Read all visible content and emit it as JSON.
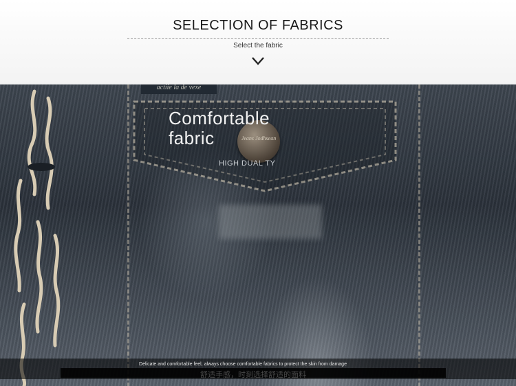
{
  "header": {
    "title": "SELECTION OF FABRICS",
    "subtitle": "Select the fabric",
    "chevron_icon": "chevron-down-icon"
  },
  "image": {
    "tag_text": "actiie la de vexe",
    "button_text": "Jeans Jodhsean"
  },
  "overlay": {
    "heading_line1": "Comfortable",
    "heading_line2": "fabric",
    "tagline": "HIGH DUAL TY"
  },
  "footer": {
    "text": "Delicate and comfortable feel, always choose comfortable fabrics to protect the skin from damage",
    "cn_text": "舒适手感，时刻选择舒适的面料"
  },
  "colors": {
    "denim_dark": "#2b323b",
    "stitch": "#d2c8b4",
    "text_light": "#f2f2f2"
  }
}
